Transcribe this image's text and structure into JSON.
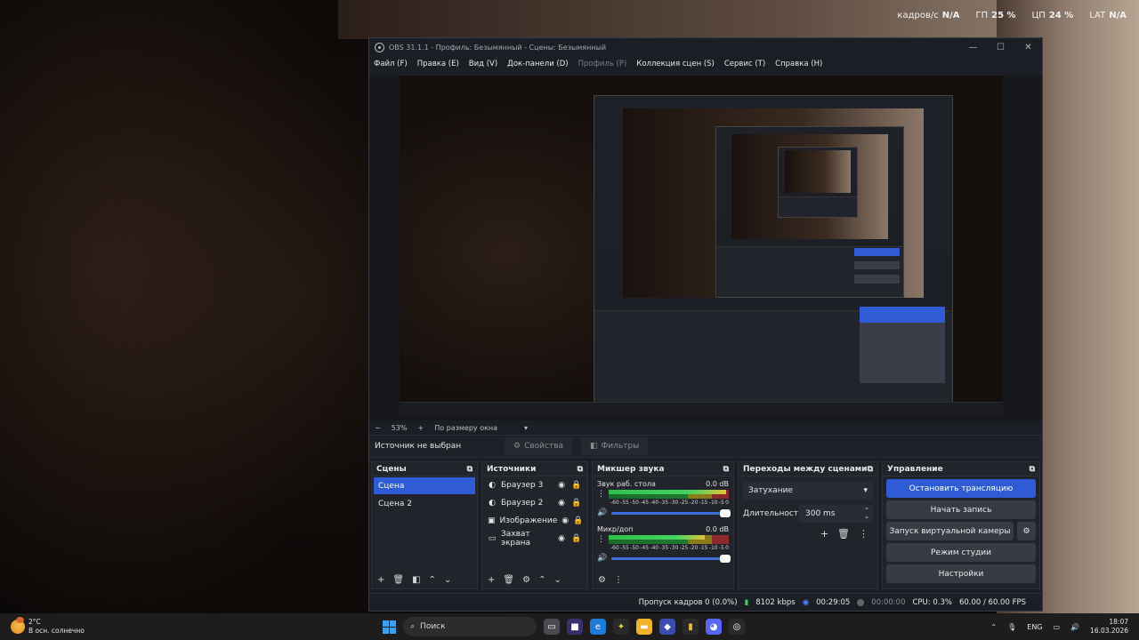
{
  "overlay": {
    "fps_label": "кадров/с",
    "fps_value": "N/A",
    "gpu_label": "ГП",
    "gpu_value": "25 %",
    "cpu_label": "ЦП",
    "cpu_value": "24 %",
    "lat_label": "LAT",
    "lat_value": "N/A"
  },
  "window": {
    "title": "OBS 31.1.1 - Профиль: Безымянный - Сцены: Безымянный",
    "minimize": "—",
    "maximize": "☐",
    "close": "✕"
  },
  "menu": [
    "Файл (F)",
    "Правка (E)",
    "Вид (V)",
    "Док-панели (D)",
    "Профиль (P)",
    "Коллекция сцен (S)",
    "Сервис (T)",
    "Справка (H)"
  ],
  "menu_disabled_index": 4,
  "zoom": {
    "minus": "−",
    "value": "53%",
    "plus": "+",
    "mode": "По размеру окна",
    "arrow": "▾"
  },
  "context": {
    "label": "Источник не выбран",
    "properties": "Свойства",
    "filters": "Фильтры"
  },
  "scenes": {
    "title": "Сцены",
    "items": [
      {
        "label": "Сцена",
        "active": true
      },
      {
        "label": "Сцена 2",
        "active": false
      }
    ]
  },
  "sources": {
    "title": "Источники",
    "items": [
      {
        "label": "Браузер 3",
        "icon": "browser-icon"
      },
      {
        "label": "Браузер 2",
        "icon": "browser-icon"
      },
      {
        "label": "Изображение",
        "icon": "image-icon"
      },
      {
        "label": "Захват экрана",
        "icon": "monitor-icon"
      }
    ]
  },
  "mixer": {
    "title": "Микшер звука",
    "scale": [
      "-60",
      "-55",
      "-50",
      "-45",
      "-40",
      "-35",
      "-30",
      "-25",
      "-20",
      "-15",
      "-10",
      "-5",
      "0"
    ],
    "channels": [
      {
        "name": "Звук раб. стола",
        "db": "0.0 dB",
        "level": 0.98
      },
      {
        "name": "Микр/доп",
        "db": "0.0 dB",
        "level": 0.8
      }
    ]
  },
  "transitions": {
    "title": "Переходы между сценами",
    "selected": "Затухание",
    "duration_label": "Длительность",
    "duration_value": "300 ms"
  },
  "controls": {
    "title": "Управление",
    "stop_stream": "Остановить трансляцию",
    "start_record": "Начать запись",
    "virtual_cam": "Запуск виртуальной камеры",
    "studio_mode": "Режим студии",
    "settings": "Настройки"
  },
  "status": {
    "dropped": "Пропуск кадров 0 (0.0%)",
    "bitrate": "8102 kbps",
    "stream_time": "00:29:05",
    "record_time": "00:00:00",
    "cpu": "CPU: 0.3%",
    "fps": "60.00 / 60.00 FPS"
  },
  "taskbar": {
    "temp": "2°C",
    "weather": "В осн. солнечно",
    "search": "Поиск",
    "lang": "ENG",
    "time": "18:07",
    "date": "16.03.2026"
  },
  "colors": {
    "accent": "#2f5bd6",
    "panel": "#22242c",
    "window": "#1c1e26"
  }
}
